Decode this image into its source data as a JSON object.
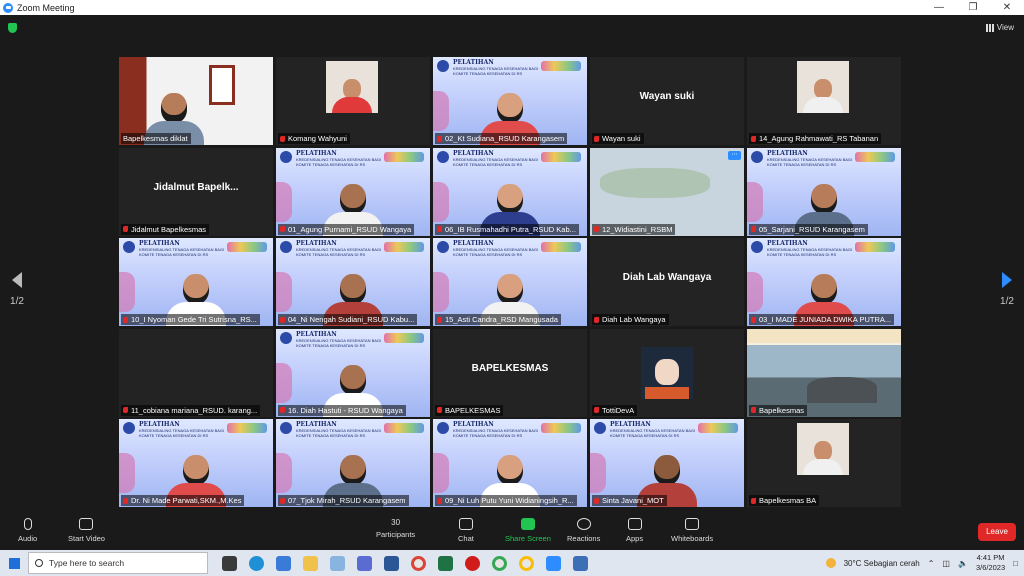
{
  "window": {
    "title": "Zoom Meeting"
  },
  "header": {
    "view_label": "View"
  },
  "pagination": {
    "left": "1/2",
    "right": "1/2"
  },
  "tiles": [
    {
      "name": "Bapelkesmas diklat",
      "kind": "video",
      "active": true
    },
    {
      "name": "Komang Wahyuni",
      "kind": "avatar"
    },
    {
      "name": "02_Kt Sudiana_RSUD Karangasem",
      "kind": "banner"
    },
    {
      "name": "Wayan suki",
      "kind": "name",
      "display": "Wayan suki"
    },
    {
      "name": "14_Agung Rahmawati_RS Tabanan",
      "kind": "avatar"
    },
    {
      "name": "Jidalmut Bapelkesmas",
      "kind": "name",
      "display": "Jidalmut  Bapelk..."
    },
    {
      "name": "01_Agung Purnami_RSUD Wangaya",
      "kind": "banner"
    },
    {
      "name": "06_IB Rusmahadhi Putra_RSUD Kab...",
      "kind": "banner"
    },
    {
      "name": "12_Widiastini_RSBM",
      "kind": "map"
    },
    {
      "name": "05_Sarjani_RSUD Karangasem",
      "kind": "banner"
    },
    {
      "name": "10_I Nyoman Gede Tri Sutrisna_RS...",
      "kind": "banner"
    },
    {
      "name": "04_Ni Nengah Sudiani_RSUD Kabu...",
      "kind": "banner"
    },
    {
      "name": "15_Asti Candra_RSD Mangusada",
      "kind": "banner"
    },
    {
      "name": "Diah Lab Wangaya",
      "kind": "name",
      "display": "Diah Lab Wangaya"
    },
    {
      "name": "03_I MADE JUNIADA DWIKA PUTRA...",
      "kind": "banner"
    },
    {
      "name": "11_cobiana mariana_RSUD. karang...",
      "kind": "empty"
    },
    {
      "name": "16. Diah Hastuti - RSUD Wangaya",
      "kind": "banner"
    },
    {
      "name": "BAPELKESMAS",
      "kind": "name",
      "display": "BAPELKESMAS"
    },
    {
      "name": "TottiDevA",
      "kind": "anime"
    },
    {
      "name": "Bapelkesmas",
      "kind": "landscape"
    },
    {
      "name": "Dr. Ni Made Parwati,SKM.,M.Kes",
      "kind": "banner"
    },
    {
      "name": "07_Tjok Mirah_RSUD Karangasem",
      "kind": "banner"
    },
    {
      "name": "09_Ni Luh Putu Yuni Widianingsih_R...",
      "kind": "banner"
    },
    {
      "name": "Sinta Javani_MOT",
      "kind": "banner"
    },
    {
      "name": "Bapelkesmas BA",
      "kind": "avatar"
    }
  ],
  "banner": {
    "title": "PELATIHAN",
    "subtitle": "KREDENSIALING TENAGA KESEHATAN BAGI KOMITE TENAGA KESEHATAN DI RS"
  },
  "toolbar": {
    "audio": "Audio",
    "video": "Start Video",
    "participants": "Participants",
    "participants_count": "30",
    "chat": "Chat",
    "share": "Share Screen",
    "reactions": "Reactions",
    "apps": "Apps",
    "whiteboards": "Whiteboards",
    "leave": "Leave"
  },
  "taskbar": {
    "search_placeholder": "Type here to search",
    "weather": "30°C  Sebagian cerah",
    "time": "4:41 PM",
    "date": "3/6/2023"
  },
  "colors": {
    "active_border": "#f3f36b",
    "leave": "#e02828",
    "share": "#23c552",
    "accent": "#2d8cff"
  }
}
